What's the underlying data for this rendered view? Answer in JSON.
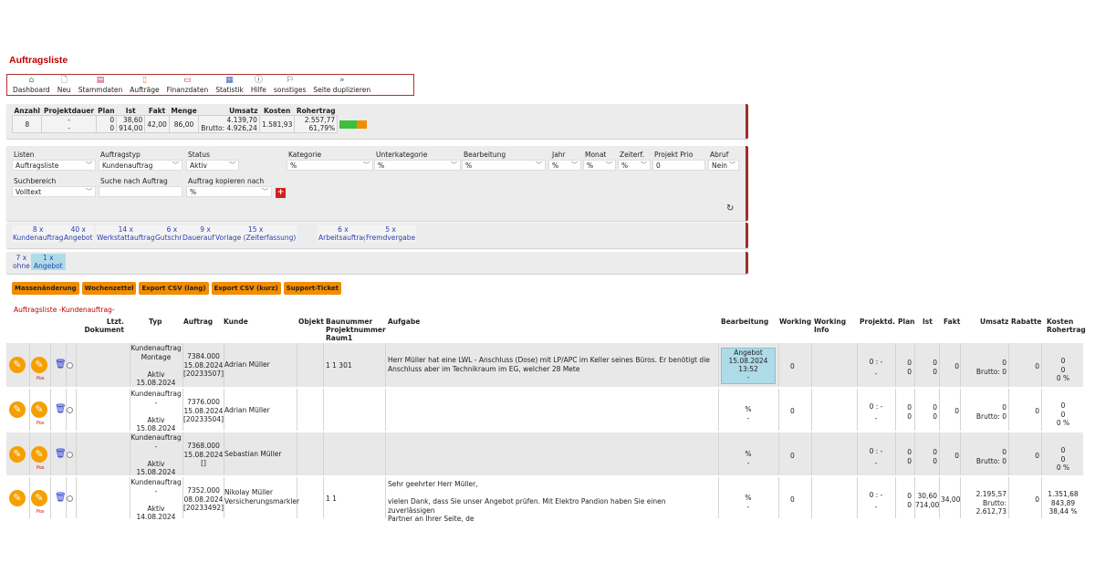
{
  "page": {
    "title": "Auftragsliste"
  },
  "toolbar": [
    {
      "label": "Dashboard",
      "icon": "home-icon"
    },
    {
      "label": "Neu",
      "icon": "new-document-icon"
    },
    {
      "label": "Stammdaten",
      "icon": "master-data-icon"
    },
    {
      "label": "Aufträge",
      "icon": "orders-icon"
    },
    {
      "label": "Finanzdaten",
      "icon": "finance-icon"
    },
    {
      "label": "Statistik",
      "icon": "statistics-icon"
    },
    {
      "label": "Hilfe",
      "icon": "help-icon"
    },
    {
      "label": "sonstiges",
      "icon": "flag-icon"
    },
    {
      "label": "Seite duplizieren",
      "icon": "double-chevron-icon"
    }
  ],
  "stats": {
    "headers": [
      "Anzahl",
      "Projektdauer",
      "Plan",
      "Ist",
      "Fakt",
      "Menge",
      "Umsatz",
      "Kosten",
      "Rohertrag"
    ],
    "anzahl": "8",
    "projektdauer": [
      "-",
      "-"
    ],
    "plan": [
      "0",
      "0"
    ],
    "ist": [
      "38,60",
      "914,00"
    ],
    "fakt": "42,00",
    "menge": "86,00",
    "umsatz": [
      "4.139,70",
      "Brutto: 4.926,24"
    ],
    "kosten": "1.581,93",
    "rohertrag": [
      "2.557,77",
      "61,79%"
    ],
    "bar_fill_fraction": 0.62
  },
  "filters": {
    "listen": {
      "label": "Listen",
      "value": "Auftragsliste"
    },
    "auftragstyp": {
      "label": "Auftragstyp",
      "value": "Kundenauftrag"
    },
    "status": {
      "label": "Status",
      "value": "Aktiv"
    },
    "kategorie": {
      "label": "Kategorie",
      "value": "%"
    },
    "unterkategorie": {
      "label": "Unterkategorie",
      "value": "%"
    },
    "bearbeitung": {
      "label": "Bearbeitung",
      "value": "%"
    },
    "jahr": {
      "label": "Jahr",
      "value": "%"
    },
    "monat": {
      "label": "Monat",
      "value": "%"
    },
    "zeiterf": {
      "label": "Zeiterf.",
      "value": "%"
    },
    "projekt_prio": {
      "label": "Projekt Prio",
      "value": "0"
    },
    "abruf": {
      "label": "Abruf",
      "value": "Nein"
    },
    "suchbereich": {
      "label": "Suchbereich",
      "value": "Volltext"
    },
    "suche": {
      "label": "Suche nach Auftrag",
      "value": ""
    },
    "kopieren": {
      "label": "Auftrag kopieren nach",
      "value": "%"
    }
  },
  "order_types": [
    {
      "count": "8 x",
      "label": "Kundenauftrag"
    },
    {
      "count": "40 x",
      "label": "Angebot"
    },
    {
      "count": "14 x",
      "label": "Werkstattauftrag"
    },
    {
      "count": "6 x",
      "label": "Gutschrift"
    },
    {
      "count": "9 x",
      "label": "Dauerauftrag"
    },
    {
      "count": "15 x",
      "label": "Vorlage (Zeiterfassung)"
    },
    {
      "count": "6 x",
      "label": "Arbeitsauftrag"
    },
    {
      "count": "5 x",
      "label": "Fremdvergabe"
    }
  ],
  "sub_status": [
    {
      "count": "7 x",
      "label": "ohne"
    },
    {
      "count": "1 x",
      "label": "Angebot"
    }
  ],
  "actions": [
    "Massenänderung",
    "Wochenzettel",
    "Export CSV (lang)",
    "Export CSV (kurz)",
    "Support-Ticket"
  ],
  "list_title": "Auftragsliste -Kundenauftrag-",
  "columns": {
    "ltzt_dokument": "Ltzt. Dokument",
    "typ": "Typ",
    "auftrag": "Auftrag",
    "kunde": "Kunde",
    "objekt": "Objekt",
    "baunummer": "Baunummer Projektnummer Raum1",
    "aufgabe": "Aufgabe",
    "bearbeitung": "Bearbeitung",
    "working": "Working",
    "working_info": "Working Info",
    "projektd": "Projektd.",
    "plan": "Plan",
    "ist": "Ist",
    "fakt": "Fakt",
    "umsatz": "Umsatz",
    "rabatte": "Rabatte",
    "kosten": "Kosten Rohertrag"
  },
  "rows": [
    {
      "typ": [
        "Kundenauftrag",
        "Montage",
        "",
        "Aktiv",
        "15.08.2024"
      ],
      "auftrag": [
        "7384.000",
        "15.08.2024",
        "[20233507]"
      ],
      "kunde": [
        "Adrian Müller"
      ],
      "baunummer": "1 1 301",
      "aufgabe": [
        "Herr Müller hat eine LWL - Anschluss (Dose) mit LP/APC im Keller seines Büros. Er benötigt die",
        "Anschluss aber im Technikraum im EG, welcher 28 Mete"
      ],
      "bearbeitung": [
        "Angebot",
        "15.08.2024",
        "13:52",
        "-"
      ],
      "bearb_highlight": true,
      "working": "0",
      "projektd": [
        "0 : -",
        "-"
      ],
      "plan": [
        "0",
        "0"
      ],
      "ist": [
        "0",
        "0"
      ],
      "fakt": "0",
      "umsatz": [
        "0",
        "Brutto: 0"
      ],
      "rabatte": "0",
      "kosten": [
        "0",
        "0",
        "0 %"
      ]
    },
    {
      "typ": [
        "Kundenauftrag",
        "-",
        "",
        "Aktiv",
        "15.08.2024"
      ],
      "auftrag": [
        "7376.000",
        "15.08.2024",
        "[20233504]"
      ],
      "kunde": [
        "Adrian Müller"
      ],
      "baunummer": "",
      "aufgabe": [
        "",
        ""
      ],
      "bearbeitung": [
        "%",
        "-"
      ],
      "bearb_highlight": false,
      "working": "0",
      "projektd": [
        "0 : -",
        "-"
      ],
      "plan": [
        "0",
        "0"
      ],
      "ist": [
        "0",
        "0"
      ],
      "fakt": "0",
      "umsatz": [
        "0",
        "Brutto: 0"
      ],
      "rabatte": "0",
      "kosten": [
        "0",
        "0",
        "0 %"
      ]
    },
    {
      "typ": [
        "Kundenauftrag",
        "-",
        "",
        "Aktiv",
        "15.08.2024"
      ],
      "auftrag": [
        "7368.000",
        "15.08.2024",
        "[]"
      ],
      "kunde": [
        "Sebastian Müller"
      ],
      "baunummer": "",
      "aufgabe": [
        "",
        ""
      ],
      "bearbeitung": [
        "%",
        "-"
      ],
      "bearb_highlight": false,
      "working": "0",
      "projektd": [
        "0 : -",
        "-"
      ],
      "plan": [
        "0",
        "0"
      ],
      "ist": [
        "0",
        "0"
      ],
      "fakt": "0",
      "umsatz": [
        "0",
        "Brutto: 0"
      ],
      "rabatte": "0",
      "kosten": [
        "0",
        "0",
        "0 %"
      ]
    },
    {
      "typ": [
        "Kundenauftrag",
        "-",
        "",
        "Aktiv",
        "14.08.2024"
      ],
      "auftrag": [
        "7352.000",
        "08.08.2024",
        "[20233492]"
      ],
      "kunde": [
        "Nikolay Müller",
        "Versicherungsmarkler"
      ],
      "baunummer": "1 1",
      "aufgabe": [
        "Sehr geehrter Herr Müller,",
        "",
        "vielen Dank, dass Sie unser Angebot prüfen. Mit Elektro Pandion haben Sie einen zuverlässigen",
        "Partner an Ihrer Seite, de"
      ],
      "bearbeitung": [
        "%",
        "-"
      ],
      "bearb_highlight": false,
      "working": "0",
      "projektd": [
        "0 : -",
        "-"
      ],
      "plan": [
        "0",
        "0"
      ],
      "ist": [
        "30,60",
        "714,00"
      ],
      "fakt": "34,00",
      "umsatz": [
        "2.195,57",
        "Brutto:",
        "2.612,73"
      ],
      "rabatte": "0",
      "kosten": [
        "1.351,68",
        "843,89",
        "38,44 %"
      ]
    }
  ],
  "colors": {
    "accent": "#c00000",
    "orange": "#f28c00",
    "link": "#2a3fb0",
    "highlight": "#aedbe8"
  }
}
